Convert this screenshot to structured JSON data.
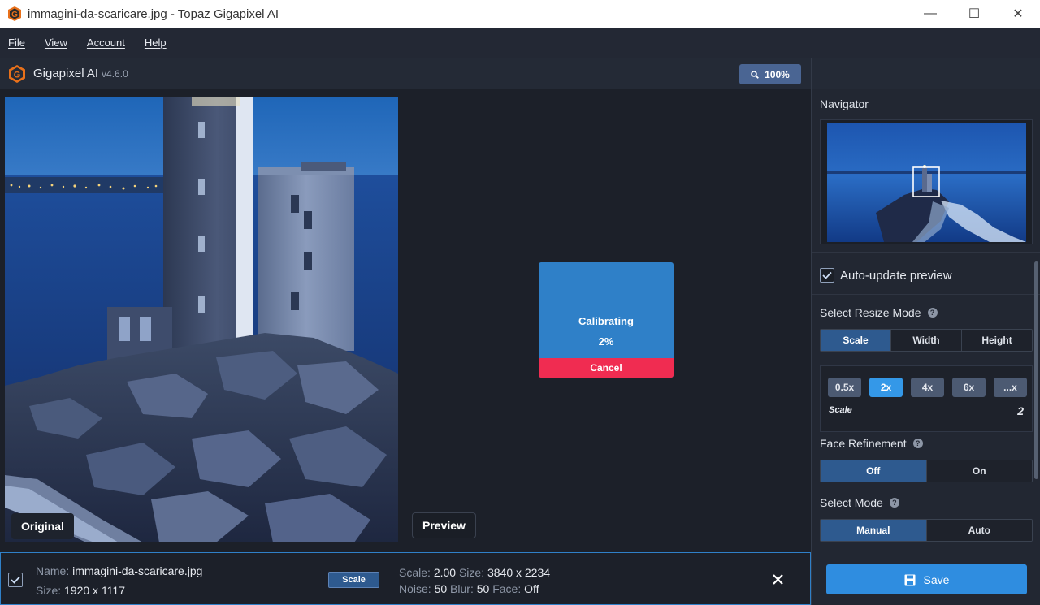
{
  "window": {
    "title": "immagini-da-scaricare.jpg - Topaz Gigapixel AI",
    "minimize": "—",
    "maximize": "☐",
    "close": "✕"
  },
  "menu": [
    "File",
    "View",
    "Account",
    "Help"
  ],
  "header": {
    "app_name": "Gigapixel AI",
    "version": "v4.6.0",
    "zoom": "100%"
  },
  "canvas": {
    "original_label": "Original",
    "preview_label": "Preview",
    "calibrating": {
      "title": "Calibrating",
      "percent": "2%",
      "cancel": "Cancel"
    }
  },
  "panel": {
    "navigator_title": "Navigator",
    "auto_update_label": "Auto-update preview",
    "auto_update_checked": true,
    "resize_mode_title": "Select Resize Mode",
    "resize_modes": [
      "Scale",
      "Width",
      "Height"
    ],
    "resize_mode_selected": "Scale",
    "scale_buttons": [
      "0.5x",
      "2x",
      "4x",
      "6x",
      "...x"
    ],
    "scale_selected": "2x",
    "scale_label": "Scale",
    "scale_value": "2",
    "face_title": "Face Refinement",
    "face_options": [
      "Off",
      "On"
    ],
    "face_selected": "Off",
    "mode_title": "Select Mode",
    "mode_options": [
      "Manual",
      "Auto"
    ],
    "mode_selected": "Manual",
    "help_glyph": "?"
  },
  "file_row": {
    "checked": true,
    "name_key": "Name:",
    "name": "immagini-da-scaricare.jpg",
    "size_key": "Size:",
    "size": "1920 x 1117",
    "mode_tag": "Scale",
    "scale_key": "Scale:",
    "scale": "2.00",
    "outsize_key": "Size:",
    "outsize": "3840 x 2234",
    "noise_key": "Noise:",
    "noise": "50",
    "blur_key": "Blur:",
    "blur": "50",
    "face_key": "Face:",
    "face": "Off"
  },
  "save_label": "Save",
  "colors": {
    "accent": "#2f8de0",
    "cancel": "#f02c51",
    "active_segment": "#2e5a8f"
  }
}
